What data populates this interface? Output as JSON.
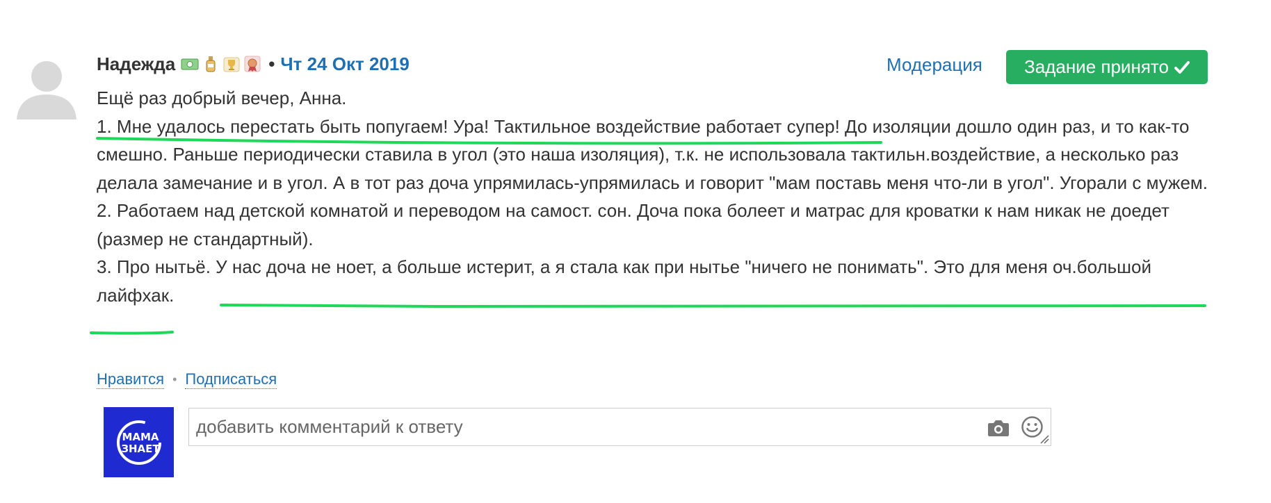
{
  "post": {
    "author": "Надежда",
    "separator": "•",
    "date": "Чт 24 Окт 2019",
    "badges": [
      "money-badge",
      "bottle-badge",
      "trophy-badge",
      "medal-badge"
    ],
    "moderation_label": "Модерация",
    "accepted_label": "Задание принято",
    "paragraphs": [
      "Ещё раз добрый вечер, Анна.",
      "1. Мне удалось перестать быть попугаем! Ура! Тактильное воздействие работает супер! До изоляции дошло один раз, и то как-то смешно. Раньше периодически ставила в угол (это наша изоляция), т.к. не использовала тактильн.воздействие, а несколько раз делала замечание и в угол. А в тот раз доча упрямилась-упрямилась и говорит \"мам поставь меня что-ли в угол\". Угорали с мужем.",
      "2. Работаем над детской комнатой и переводом на самост. сон. Доча пока болеет и матрас для кроватки к нам никак не доедет (размер не стандартный).",
      "3. Про нытьё. У нас доча не ноет, а больше истерит, а я стала как при нытье \"ничего не понимать\". Это для меня оч.большой лайфхак."
    ]
  },
  "actions": {
    "like_label": "Нравится",
    "bullet": "•",
    "subscribe_label": "Подписаться"
  },
  "comment": {
    "placeholder": "добавить комментарий к ответу",
    "avatar_text_line1": "МАМА",
    "avatar_text_line2": "ЗНАЕТ"
  },
  "colors": {
    "accent_blue": "#1f6fb2",
    "accept_green": "#28ae60",
    "highlight_green": "#1fd85a",
    "avatar_blue": "#1f2bd0"
  }
}
